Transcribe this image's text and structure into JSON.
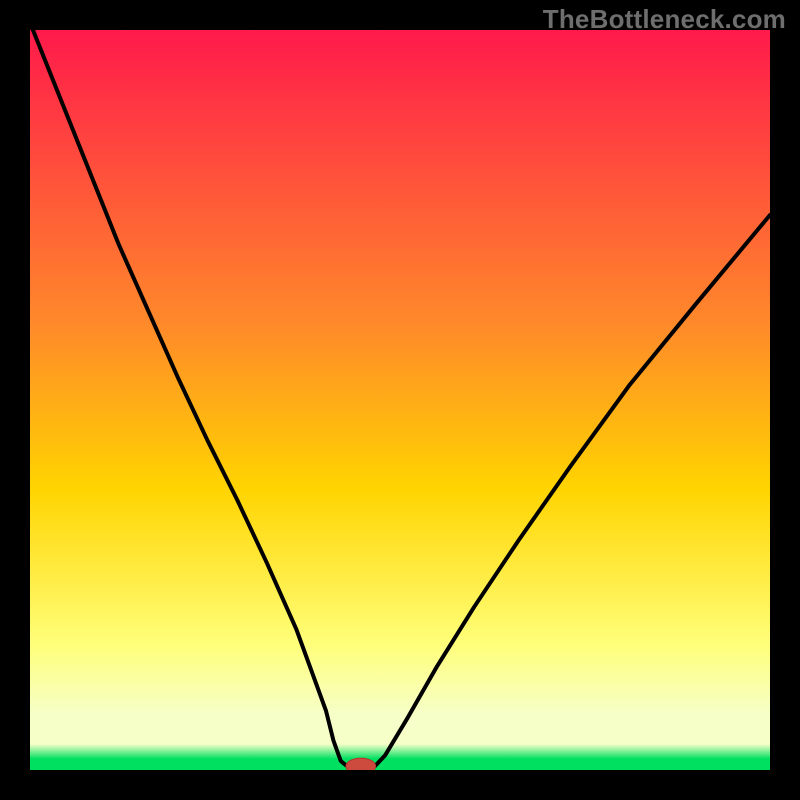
{
  "watermark": "TheBottleneck.com",
  "colors": {
    "frame": "#000000",
    "grad_top": "#ff1a4b",
    "grad_mid_upper": "#ff8a2a",
    "grad_mid": "#ffd400",
    "grad_low": "#ffff7a",
    "grad_paleband": "#f6ffc8",
    "grad_green": "#00e060",
    "curve": "#000000",
    "marker_fill": "#cc4a3e",
    "marker_stroke": "#b53a30"
  },
  "chart_data": {
    "type": "line",
    "title": "",
    "xlabel": "",
    "ylabel": "",
    "xlim": [
      0,
      100
    ],
    "ylim": [
      0,
      100
    ],
    "series": [
      {
        "name": "left-branch",
        "x": [
          0,
          4,
          8,
          12,
          16,
          20,
          24,
          28,
          32,
          36,
          40,
          41,
          42,
          43
        ],
        "values": [
          101,
          91,
          81,
          71,
          62,
          53,
          44.5,
          36.5,
          28,
          19,
          8,
          4,
          1.2,
          0.4
        ]
      },
      {
        "name": "floor",
        "x": [
          43,
          46.5
        ],
        "values": [
          0.4,
          0.4
        ]
      },
      {
        "name": "right-branch",
        "x": [
          46.5,
          48,
          51,
          55,
          60,
          66,
          73,
          81,
          90,
          100
        ],
        "values": [
          0.4,
          2,
          7,
          14,
          22,
          31,
          41,
          52,
          63,
          75
        ]
      }
    ],
    "marker": {
      "x": 44.7,
      "y": 0.5,
      "rx": 2.0,
      "ry": 1.1
    },
    "gradient_stops": [
      {
        "offset": 0.0,
        "color_key": "grad_top"
      },
      {
        "offset": 0.4,
        "color_key": "grad_mid_upper"
      },
      {
        "offset": 0.62,
        "color_key": "grad_mid"
      },
      {
        "offset": 0.83,
        "color_key": "grad_low"
      },
      {
        "offset": 0.925,
        "color_key": "grad_paleband"
      },
      {
        "offset": 0.965,
        "color_key": "grad_paleband"
      },
      {
        "offset": 0.985,
        "color_key": "grad_green"
      },
      {
        "offset": 1.0,
        "color_key": "grad_green"
      }
    ]
  }
}
